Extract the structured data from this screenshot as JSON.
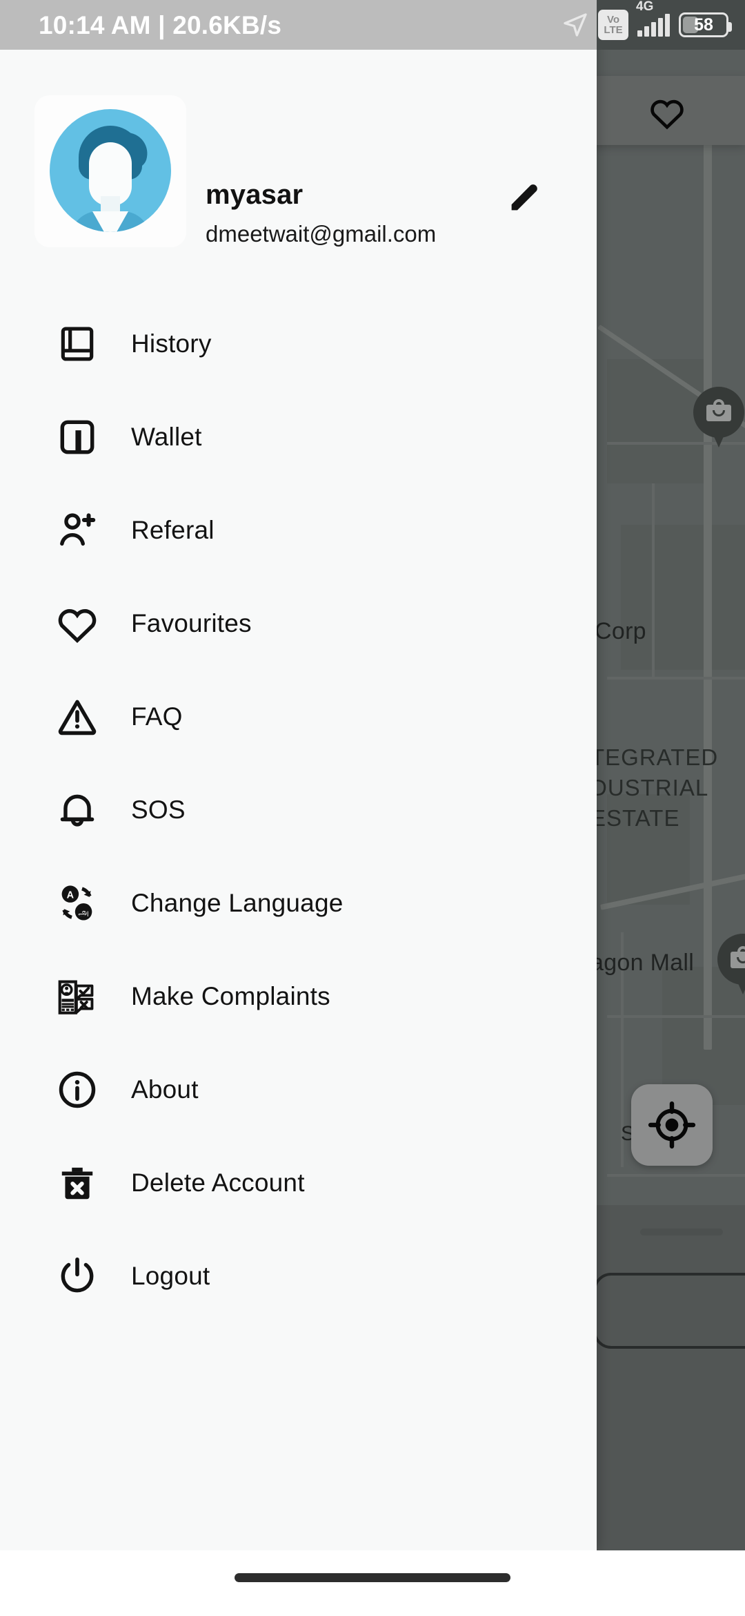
{
  "status_bar": {
    "time": "10:14 AM",
    "separator": "|",
    "network_speed": "20.6KB/s",
    "time_and_speed": "10:14 AM | 20.6KB/s",
    "location_icon": "location-arrow-icon",
    "volte_top": "Vo",
    "volte_bottom": "LTE",
    "network_type": "4G",
    "signal_icon": "signal-bars-icon",
    "battery_level": "58"
  },
  "drawer": {
    "profile": {
      "name": "myasar",
      "email": "dmeetwait@gmail.com",
      "avatar_icon": "user-avatar-placeholder",
      "edit_icon": "pencil-edit-icon"
    },
    "menu_items": [
      {
        "label": "History",
        "icon": "book-icon"
      },
      {
        "label": "Wallet",
        "icon": "wallet-icon"
      },
      {
        "label": "Referal",
        "icon": "person-add-icon"
      },
      {
        "label": "Favourites",
        "icon": "heart-outline-icon"
      },
      {
        "label": "FAQ",
        "icon": "warning-triangle-icon"
      },
      {
        "label": "SOS",
        "icon": "bell-icon"
      },
      {
        "label": "Change Language",
        "icon": "translate-icon"
      },
      {
        "label": "Make Complaints",
        "icon": "complaint-document-icon"
      },
      {
        "label": "About",
        "icon": "info-circle-icon"
      },
      {
        "label": "Delete Account",
        "icon": "trash-x-icon"
      },
      {
        "label": "Logout",
        "icon": "power-icon"
      }
    ]
  },
  "map": {
    "favourites_card_icon": "heart-outline-icon",
    "my_location_icon": "my-location-crosshair-icon",
    "labels": [
      {
        "text": "Corp"
      },
      {
        "text": "TEGRATED"
      },
      {
        "text": "DUSTRIAL"
      },
      {
        "text": "ESTATE"
      },
      {
        "text": "agon Mall"
      },
      {
        "text": "S"
      }
    ],
    "markers": [
      {
        "icon": "shop-bag-pin-icon"
      },
      {
        "icon": "shop-bag-pin-icon"
      }
    ]
  },
  "nav_bar": {
    "gesture_handle": "home-gesture-pill"
  },
  "colors": {
    "drawer_bg": "#f8f9f9",
    "status_bar_left": "#bcbcbc",
    "status_bar_right": "#454a49",
    "avatar_blue": "#62c0e4",
    "avatar_hair": "#1f6f93",
    "text_primary": "#131313",
    "map_bg": "#808786",
    "nav_bar": "#ffffff"
  }
}
